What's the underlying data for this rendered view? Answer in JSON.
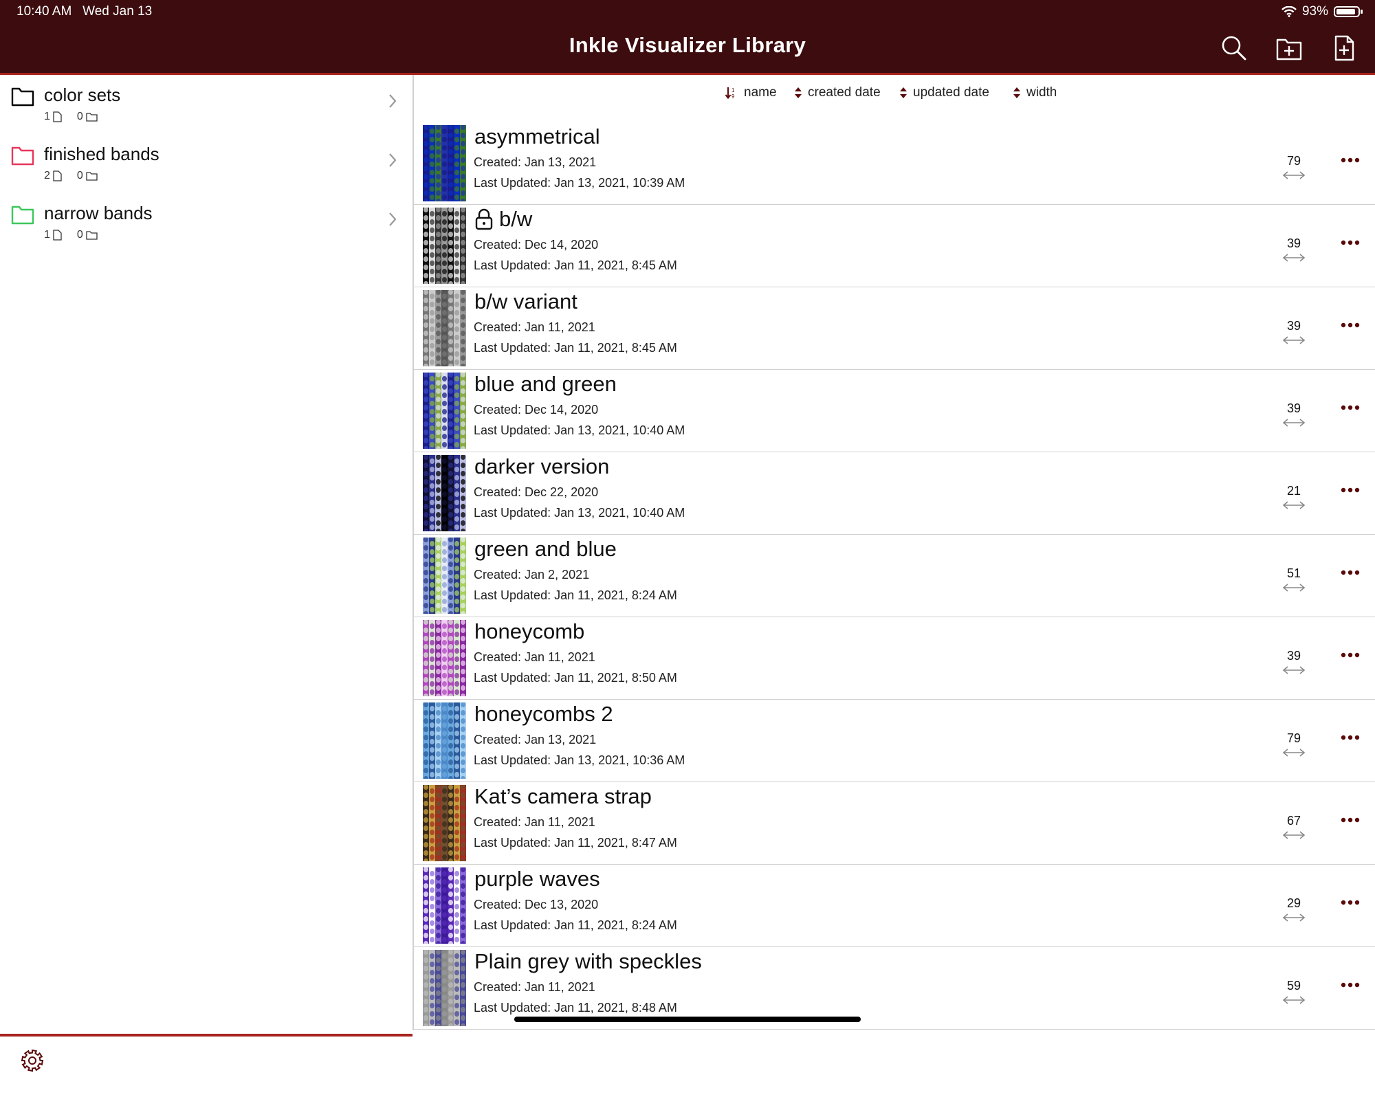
{
  "status": {
    "time": "10:40 AM",
    "date": "Wed Jan 13",
    "battery": "93%"
  },
  "header": {
    "title": "Inkle Visualizer Library"
  },
  "sidebar": {
    "folders": [
      {
        "name": "color sets",
        "files": "1",
        "folders": "0",
        "color": "#000000"
      },
      {
        "name": "finished bands",
        "files": "2",
        "folders": "0",
        "color": "#e8355a"
      },
      {
        "name": "narrow bands",
        "files": "1",
        "folders": "0",
        "color": "#3cc85a"
      }
    ]
  },
  "sort": {
    "name": "name",
    "created": "created date",
    "updated": "updated date",
    "width": "width"
  },
  "patterns": [
    {
      "name": "asymmetrical",
      "created": "Created: Jan 13, 2021",
      "updated": "Last Updated: Jan 13, 2021, 10:39 AM",
      "width": "79",
      "locked": false,
      "colors": [
        "#1a1a8c",
        "#0a2fb8",
        "#3a7a2a",
        "#2233aa"
      ]
    },
    {
      "name": "b/w",
      "created": "Created: Dec 14, 2020",
      "updated": "Last Updated: Jan 11, 2021, 8:45 AM",
      "width": "39",
      "locked": true,
      "colors": [
        "#111111",
        "#dddddd",
        "#333333",
        "#999999"
      ]
    },
    {
      "name": "b/w variant",
      "created": "Created: Jan 11, 2021",
      "updated": "Last Updated: Jan 11, 2021, 8:45 AM",
      "width": "39",
      "locked": false,
      "colors": [
        "#777777",
        "#cccccc",
        "#999999",
        "#555555"
      ]
    },
    {
      "name": "blue and green",
      "created": "Created: Dec 14, 2020",
      "updated": "Last Updated: Jan 13, 2021, 10:40 AM",
      "width": "39",
      "locked": false,
      "colors": [
        "#1b1f8a",
        "#3b4cc0",
        "#88aa44",
        "#d9dcef"
      ]
    },
    {
      "name": "darker version",
      "created": "Created: Dec 22, 2020",
      "updated": "Last Updated: Jan 13, 2021, 10:40 AM",
      "width": "21",
      "locked": false,
      "colors": [
        "#111133",
        "#2a2f8a",
        "#b9bde0",
        "#000000"
      ]
    },
    {
      "name": "green and blue",
      "created": "Created: Jan 2, 2021",
      "updated": "Last Updated: Jan 11, 2021, 8:24 AM",
      "width": "51",
      "locked": false,
      "colors": [
        "#8aa0d8",
        "#2a3a8a",
        "#a8d060",
        "#e8ecf8"
      ]
    },
    {
      "name": "honeycomb",
      "created": "Created: Jan 11, 2021",
      "updated": "Last Updated: Jan 11, 2021, 8:50 AM",
      "width": "39",
      "locked": false,
      "colors": [
        "#b048c0",
        "#d8e8d0",
        "#8a2aa0",
        "#f0d0f0"
      ]
    },
    {
      "name": "honeycombs 2",
      "created": "Created: Jan 13, 2021",
      "updated": "Last Updated: Jan 13, 2021, 10:36 AM",
      "width": "79",
      "locked": false,
      "colors": [
        "#6aa8e0",
        "#2a5a9a",
        "#a8d0f0",
        "#4a88c8"
      ]
    },
    {
      "name": "Kat’s camera strap",
      "created": "Created: Jan 11, 2021",
      "updated": "Last Updated: Jan 11, 2021, 8:47 AM",
      "width": "67",
      "locked": false,
      "colors": [
        "#3a2a1a",
        "#c8a040",
        "#a03020",
        "#705030"
      ]
    },
    {
      "name": "purple waves",
      "created": "Created: Dec 13, 2020",
      "updated": "Last Updated: Jan 11, 2021, 8:24 AM",
      "width": "29",
      "locked": false,
      "colors": [
        "#5a2ab8",
        "#ffffff",
        "#8a6ad8",
        "#3a1a98"
      ]
    },
    {
      "name": "Plain grey with speckles",
      "created": "Created: Jan 11, 2021",
      "updated": "Last Updated: Jan 11, 2021, 8:48 AM",
      "width": "59",
      "locked": false,
      "colors": [
        "#9a9a9a",
        "#bbbbbb",
        "#4a4a9a",
        "#888888"
      ]
    }
  ],
  "theme": {
    "bar": "#3c0c0e",
    "accent": "#a8231f",
    "icon": "#5a0a0a"
  }
}
